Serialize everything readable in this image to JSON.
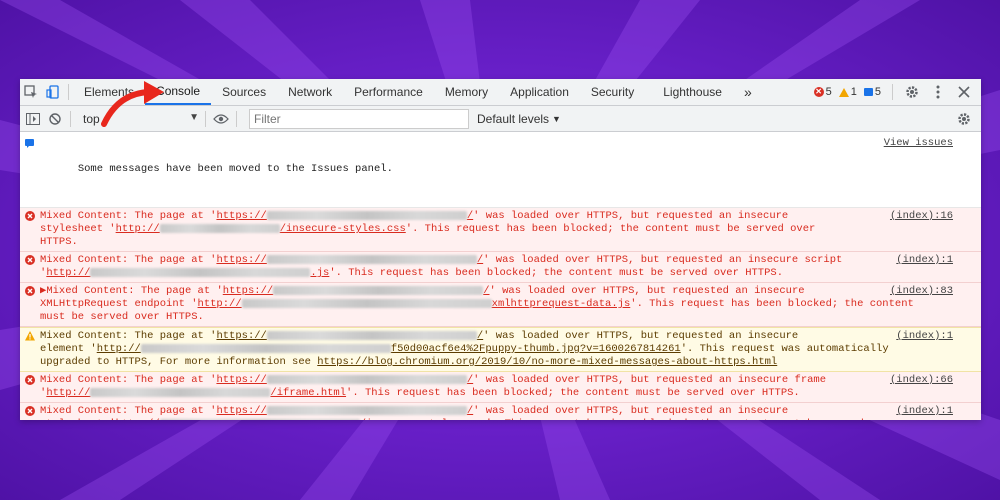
{
  "devtools": {
    "tabs": [
      "Elements",
      "Console",
      "Sources",
      "Network",
      "Performance",
      "Memory",
      "Application",
      "Security",
      "Lighthouse"
    ],
    "active_tab": "Console",
    "more_tabs": "»",
    "counts": {
      "errors": "5",
      "warnings": "1",
      "info": "5"
    },
    "toolbar": {
      "context": "top",
      "filter_placeholder": "Filter",
      "levels": "Default levels"
    }
  },
  "issues_notice": {
    "text": "Some messages have been moved to the Issues panel.",
    "link": "View issues"
  },
  "messages": [
    {
      "level": "error",
      "a": "Mixed Content: The page at '",
      "b": "https://",
      "c": "/",
      "d": "' was loaded over HTTPS, but requested an insecure\nstylesheet '",
      "e": "http://",
      "f": "/insecure-styles.css",
      "g": "'. This request has been blocked; the content must be served over\nHTTPS.",
      "source": "(index):16"
    },
    {
      "level": "error",
      "a": "Mixed Content: The page at '",
      "b": "https://",
      "c": "/",
      "d": "' was loaded over HTTPS, but requested an insecure script\n'",
      "e": "http://",
      "f": ".js",
      "g": "'. This request has been blocked; the content must be served over HTTPS.",
      "source": "(index):1"
    },
    {
      "level": "error",
      "a": "▶Mixed Content: The page at '",
      "b": "https://",
      "c": "/",
      "d": "' was loaded over HTTPS, but requested an insecure\nXMLHttpRequest endpoint '",
      "e": "http://",
      "f": "xmlhttprequest-data.js",
      "g": "'. This request has been blocked; the content\nmust be served over HTTPS.",
      "source": "(index):83"
    },
    {
      "level": "warn",
      "a": "Mixed Content: The page at '",
      "b": "https://",
      "c": "/",
      "d": "' was loaded over HTTPS, but requested an insecure\nelement '",
      "e": "http://",
      "f": "f50d00acf6e4%2Fpuppy-thumb.jpg?v=1600267814261",
      "g": "'. This request was automatically\nupgraded to HTTPS, For more information see ",
      "h": "https://blog.chromium.org/2019/10/no-more-mixed-messages-about-https.html",
      "source": "(index):1"
    },
    {
      "level": "error",
      "a": "Mixed Content: The page at '",
      "b": "https://",
      "c": "/",
      "d": "' was loaded over HTTPS, but requested an insecure frame\n'",
      "e": "http://",
      "f": "/iframe.html",
      "g": "'. This request has been blocked; the content must be served over HTTPS.",
      "source": "(index):66"
    },
    {
      "level": "error",
      "a": "Mixed Content: The page at '",
      "b": "https://",
      "c": "/",
      "d": "' was loaded over HTTPS, but requested an insecure\nstylesheet '",
      "e": "http://",
      "f": "/insecure-styles.css",
      "g": "'. This request has been blocked; the content must be served over\nHTTPS.",
      "source": "(index):1"
    }
  ],
  "prompt_symbol": "›",
  "colors": {
    "background": "#6d22cf",
    "error_text": "#d92b1f",
    "error_bg": "#fff0f0",
    "warn_bg": "#fffbe5",
    "accent": "#1a73e8",
    "arrow": "#e8271d"
  }
}
